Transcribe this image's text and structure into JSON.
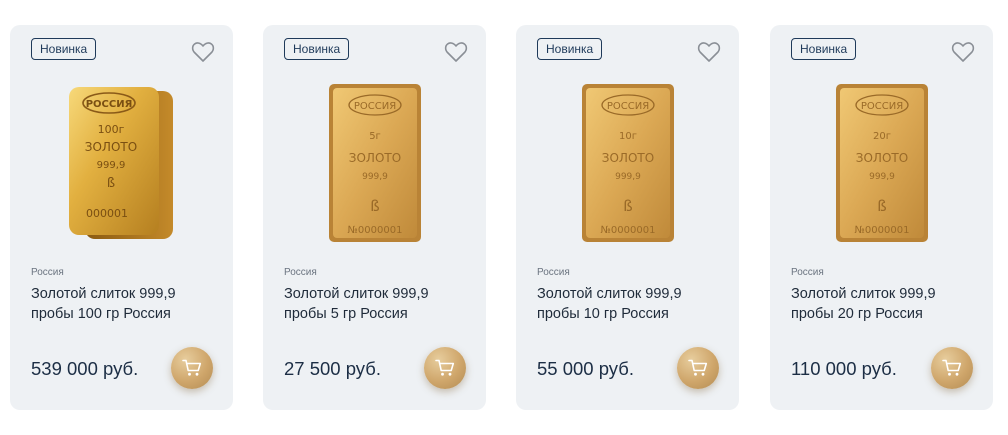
{
  "products": [
    {
      "badge": "Новинка",
      "country": "Россия",
      "title": "Золотой слиток 999,9 пробы 100 гр Россия",
      "price": "539 000 руб.",
      "bar": {
        "brand": "РОССИЯ",
        "weight": "100г",
        "metal": "ЗОЛОТО",
        "fineness": "999,9",
        "serial": "000001"
      }
    },
    {
      "badge": "Новинка",
      "country": "Россия",
      "title": "Золотой слиток 999,9 пробы 5 гр Россия",
      "price": "27 500 руб.",
      "bar": {
        "brand": "РОССИЯ",
        "weight": "5г",
        "metal": "ЗОЛОТО",
        "fineness": "999,9",
        "serial": "№0000001"
      }
    },
    {
      "badge": "Новинка",
      "country": "Россия",
      "title": "Золотой слиток 999,9 пробы 10 гр Россия",
      "price": "55 000 руб.",
      "bar": {
        "brand": "РОССИЯ",
        "weight": "10г",
        "metal": "ЗОЛОТО",
        "fineness": "999,9",
        "serial": "№0000001"
      }
    },
    {
      "badge": "Новинка",
      "country": "Россия",
      "title": "Золотой слиток 999,9 пробы 20 гр Россия",
      "price": "110 000 руб.",
      "bar": {
        "brand": "РОССИЯ",
        "weight": "20г",
        "metal": "ЗОЛОТО",
        "fineness": "999,9",
        "serial": "№0000001"
      }
    }
  ],
  "icons": {
    "favorite": "heart-icon",
    "cart": "cart-icon"
  },
  "colors": {
    "card_bg": "#eef1f4",
    "price": "#1c2e45",
    "badge_border": "#1f3a5a",
    "gold": "#cfa66b"
  }
}
